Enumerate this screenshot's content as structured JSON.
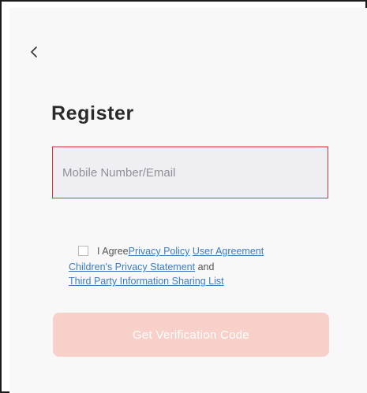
{
  "header": {
    "back_icon": "chevron-left-icon",
    "title": "Register"
  },
  "form": {
    "account_field": {
      "placeholder": "Mobile Number/Email",
      "value": "",
      "border_color": "#d9343c"
    },
    "agreement": {
      "checked": false,
      "prefix": "I Agree",
      "privacy_policy": "Privacy Policy",
      "user_agreement": "User Agreement",
      "childrens_privacy": "Children's Privacy Statement",
      "and": " and",
      "third_party": "Third Party Information Sharing List",
      "link_color": "#3c7cc4"
    },
    "submit": {
      "label": "Get Verification Code",
      "enabled": false,
      "background": "#f7d0c9"
    }
  }
}
